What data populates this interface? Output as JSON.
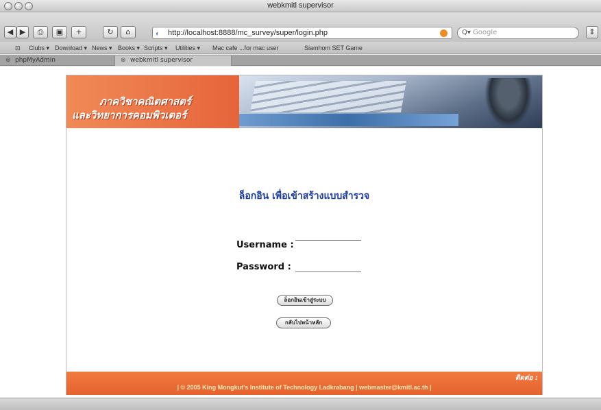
{
  "window": {
    "title": "webkmitl supervisor"
  },
  "toolbar": {
    "url": "http://localhost:8888/mc_survey/super/login.php",
    "search_placeholder": "Google"
  },
  "bookmarks": [
    "Clubs ▾",
    "Download ▾",
    "News ▾",
    "Books ▾",
    "Scripts ▾",
    "Utilities ▾",
    "Mac cafe ...for mac user",
    "Siamhom SET Game"
  ],
  "tabs": [
    {
      "label": "phpMyAdmin",
      "active": false
    },
    {
      "label": "webkmitl supervisor",
      "active": true
    }
  ],
  "banner": {
    "line1": "ภาควิชาคณิตศาสตร์",
    "line2": "และวิทยาการคอมพิวเตอร์"
  },
  "login": {
    "heading": "ล็อกอิน เพื่อเข้าสร้างแบบสำรวจ",
    "username_label": "Username :",
    "password_label": "Password :",
    "username_value": "",
    "password_value": "",
    "login_button": "ล็อกอินเข้าสู่ระบบ",
    "back_button": "กลับไปหน้าหลัก"
  },
  "footer": {
    "right_label": "ติดต่อ :",
    "copyright": "| © 2005 King Mongkut's Institute of Technology Ladkrabang | webmaster@kmitl.ac.th |"
  }
}
